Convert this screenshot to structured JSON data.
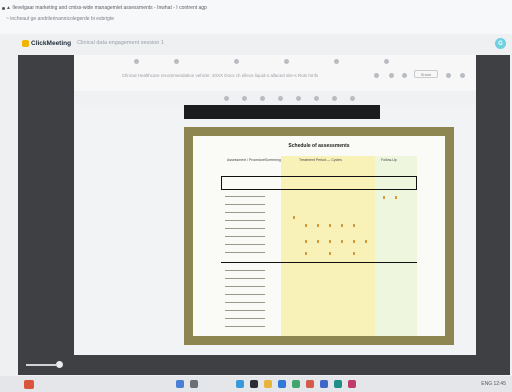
{
  "browser": {
    "line1": "▲ Ilevelgaar marketing and cmiss-wide managemiet assessments - Inwhat - I contrent agp",
    "line2": "~ incheaut ge andrilerinannicolegerde bi esbrigte"
  },
  "app": {
    "logo_text": "ClickMeeting",
    "meeting_title": "Clinical data engagement session 1",
    "avatar_initial": "G"
  },
  "document": {
    "toolbar_text": "Cllnical Healthcare recommendation vehicle: 20XX Docs ch ellece liquid-s allaced site-s   Ruts   hmfs",
    "badge": "Share"
  },
  "sheet": {
    "title": "Schedule of assessments",
    "header_left": "Assessment / Procedure",
    "header_screen": "Screening",
    "header_treat": "Treatment Period — Cycles",
    "header_follow": "Follow-Up"
  },
  "taskbar": {
    "tray_text": "ENG  12:45"
  },
  "colors": {
    "stage": "#3f4044",
    "slide_border": "#8d8651",
    "highlight_yellow": "#f8f1b8",
    "highlight_green": "#eef6de",
    "brand_accent": "#f2b400"
  }
}
